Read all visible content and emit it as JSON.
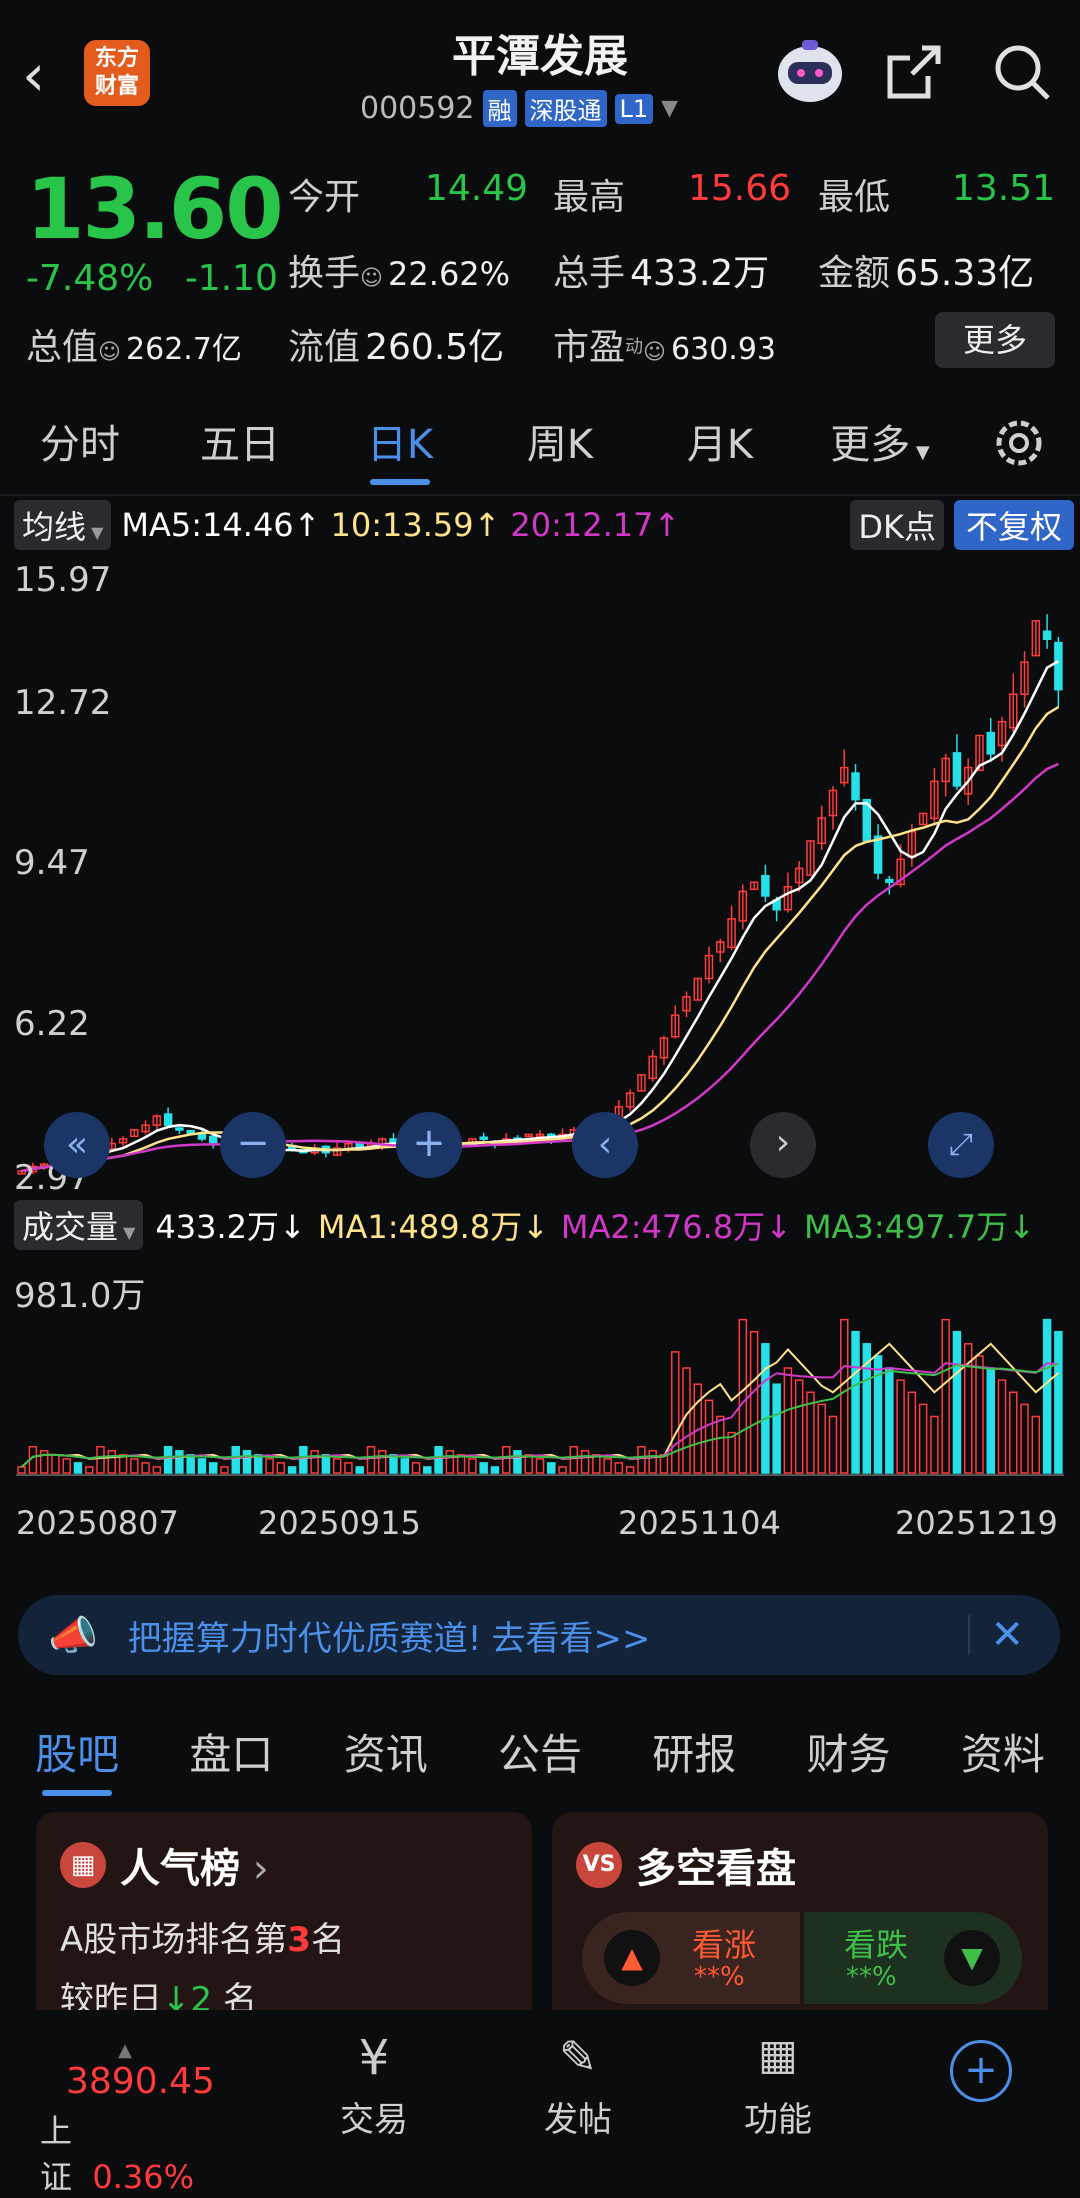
{
  "header": {
    "back_icon": "chevron-left-icon",
    "logo_text": "东方\n财富",
    "title": "平潭发展",
    "code": "000592",
    "tags": [
      "融",
      "深股通",
      "L1"
    ]
  },
  "quote": {
    "price": "13.60",
    "change_pct": "-7.48%",
    "change": "-1.10",
    "open_label": "今开",
    "open": "14.49",
    "high_label": "最高",
    "high": "15.66",
    "low_label": "最低",
    "low": "13.51",
    "turnover_label": "换手",
    "turnover": "22.62%",
    "volume_label": "总手",
    "volume": "433.2万",
    "amount_label": "金额",
    "amount": "65.33亿",
    "mcap_label": "总值",
    "mcap": "262.7亿",
    "float_label": "流值",
    "float": "260.5亿",
    "pe_label": "市盈",
    "pe_sup": "动",
    "pe": "630.93",
    "more": "更多"
  },
  "tabs": [
    "分时",
    "五日",
    "日K",
    "周K",
    "月K",
    "更多"
  ],
  "active_tab": "日K",
  "ma": {
    "selector": "均线",
    "ma5": "MA5:14.46",
    "ma10": "10:13.59",
    "ma20": "20:12.17",
    "dk": "DK点",
    "adjust": "不复权"
  },
  "price_axis": [
    "15.97",
    "12.72",
    "9.47",
    "6.22",
    "2.97"
  ],
  "volume_header": {
    "selector": "成交量",
    "vol": "433.2万",
    "ma1": "MA1:489.8万",
    "ma2": "MA2:476.8万",
    "ma3": "MA3:497.7万",
    "max": "981.0万"
  },
  "dates": [
    "20250807",
    "20250915",
    "20251104",
    "20251219"
  ],
  "banner": {
    "text": "把握算力时代优质赛道!",
    "link": "去看看>>"
  },
  "subtabs": [
    "股吧",
    "盘口",
    "资讯",
    "公告",
    "研报",
    "财务",
    "资料"
  ],
  "popularity": {
    "title": "人气榜",
    "rank_prefix": "A股市场排名第",
    "rank": "3",
    "rank_suffix": "名",
    "change_prefix": "较昨日",
    "change": "2",
    "change_suffix": "名"
  },
  "longshort": {
    "title": "多空看盘",
    "up": "看涨",
    "up_pct": "**%",
    "down": "看跌",
    "down_pct": "**%"
  },
  "index": {
    "value": "3890.45",
    "name": "上证",
    "pct": "0.36%"
  },
  "nav": [
    "交易",
    "发帖",
    "功能"
  ],
  "colors": {
    "up": "#ff3b3b",
    "down": "#29c44a",
    "accent": "#4c8fe8",
    "candle_down": "#27e0e8",
    "ma5": "#ffffff",
    "ma10": "#ffe28a",
    "ma20": "#d238c8"
  },
  "chart_data": {
    "type": "candlestick",
    "yaxis": [
      2.97,
      15.97
    ],
    "closes": [
      3.1,
      3.2,
      3.25,
      3.3,
      3.5,
      3.4,
      3.5,
      3.6,
      3.7,
      3.8,
      4.0,
      4.1,
      4.3,
      4.1,
      4.0,
      3.9,
      3.8,
      3.7,
      3.7,
      3.6,
      3.6,
      3.5,
      3.5,
      3.6,
      3.6,
      3.5,
      3.6,
      3.5,
      3.6,
      3.7,
      3.6,
      3.7,
      3.8,
      3.7,
      3.7,
      3.8,
      3.7,
      3.6,
      3.7,
      3.7,
      3.8,
      3.8,
      3.7,
      3.8,
      3.8,
      3.9,
      3.9,
      3.8,
      3.9,
      4.0,
      4.0,
      4.1,
      4.3,
      4.5,
      4.8,
      5.2,
      5.6,
      6.0,
      6.5,
      6.9,
      7.3,
      7.8,
      8.1,
      8.6,
      9.2,
      9.4,
      9.1,
      8.8,
      9.3,
      9.7,
      10.3,
      10.8,
      11.4,
      11.9,
      11.2,
      10.3,
      9.6,
      9.4,
      9.9,
      10.5,
      10.9,
      11.6,
      12.1,
      11.5,
      11.9,
      12.6,
      12.2,
      12.9,
      13.5,
      14.2,
      15.1,
      14.7,
      13.6
    ]
  }
}
